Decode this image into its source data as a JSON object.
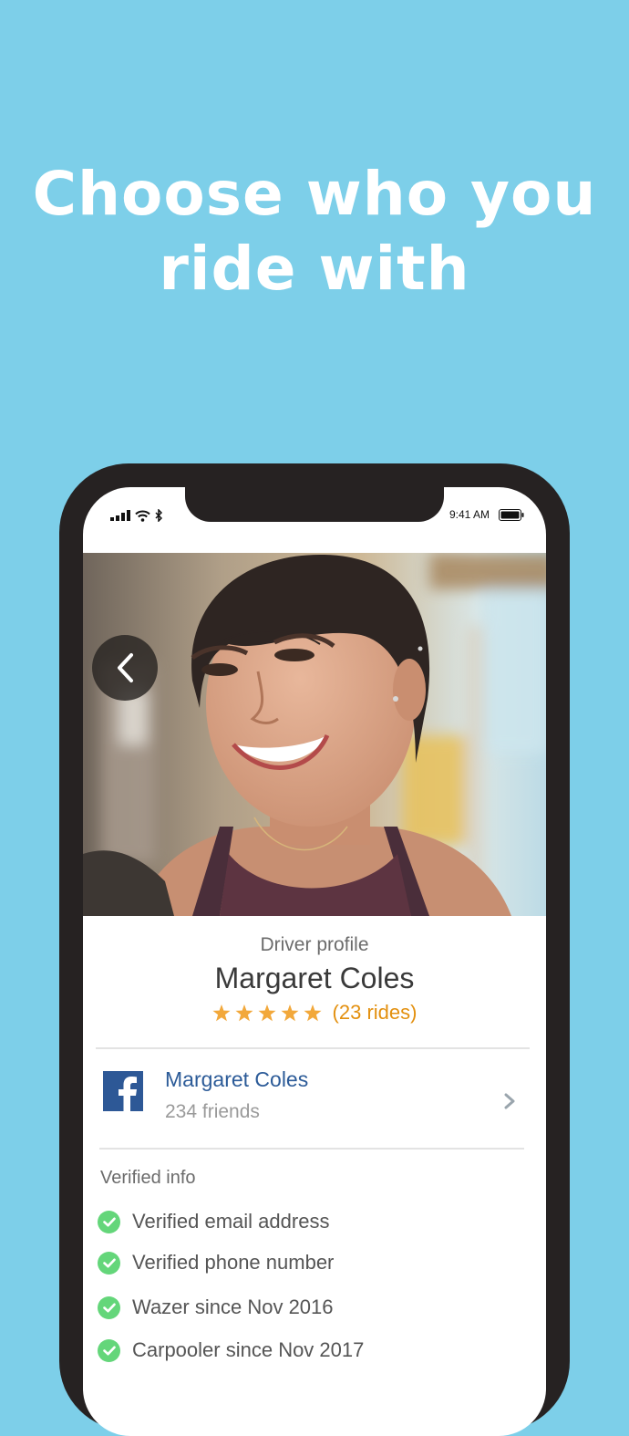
{
  "headline": {
    "line1": "Choose who you",
    "line2": "ride with"
  },
  "status_bar": {
    "time": "9:41 AM"
  },
  "profile": {
    "label": "Driver profile",
    "name": "Margaret Coles",
    "rating_stars": 5,
    "rides_text": "(23 rides)"
  },
  "facebook": {
    "name": "Margaret Coles",
    "friends": "234 friends"
  },
  "verified": {
    "title": "Verified info",
    "items": [
      "Verified email address",
      "Verified phone number",
      "Wazer since Nov 2016",
      "Carpooler since Nov 2017"
    ]
  },
  "colors": {
    "background": "#7dcfe9",
    "phone_frame": "#262222",
    "star": "#f2a83b",
    "rides_text": "#e3900f",
    "facebook_blue": "#2d5896",
    "check_green": "#64d67a"
  }
}
